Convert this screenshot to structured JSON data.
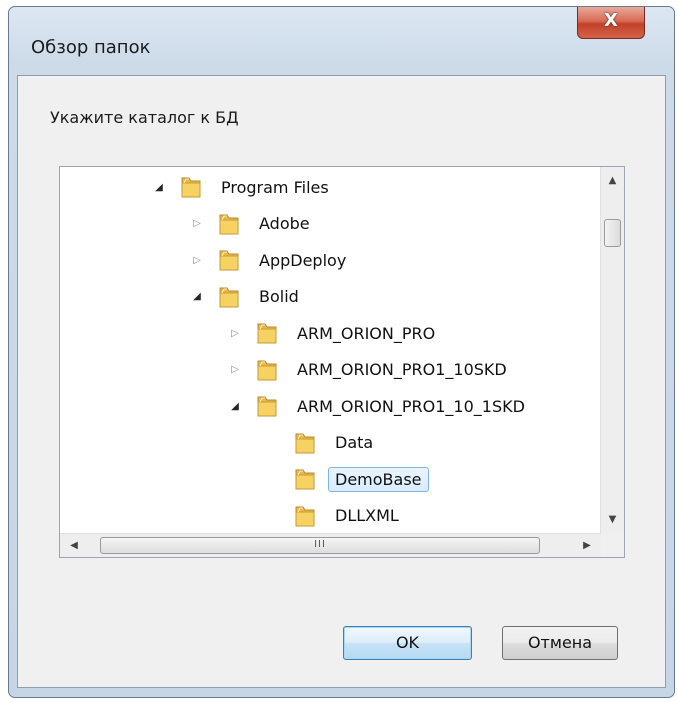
{
  "window": {
    "title": "Обзор папок",
    "close_glyph": "X"
  },
  "dialog": {
    "prompt": "Укажите каталог к БД"
  },
  "tree": {
    "nodes": [
      {
        "label": "Program Files",
        "depth": 0,
        "expander": "open"
      },
      {
        "label": "Adobe",
        "depth": 1,
        "expander": "closed"
      },
      {
        "label": "AppDeploy",
        "depth": 1,
        "expander": "closed"
      },
      {
        "label": "Bolid",
        "depth": 1,
        "expander": "open"
      },
      {
        "label": "ARM_ORION_PRO",
        "depth": 2,
        "expander": "closed"
      },
      {
        "label": "ARM_ORION_PRO1_10SKD",
        "depth": 2,
        "expander": "closed"
      },
      {
        "label": "ARM_ORION_PRO1_10_1SKD",
        "depth": 2,
        "expander": "open"
      },
      {
        "label": "Data",
        "depth": 3,
        "expander": "none"
      },
      {
        "label": "DemoBase",
        "depth": 3,
        "expander": "none",
        "selected": true
      },
      {
        "label": "DLLXML",
        "depth": 3,
        "expander": "none"
      }
    ],
    "hscroll_grip": "III"
  },
  "buttons": {
    "ok_label": "OK",
    "cancel_label": "Отмена"
  },
  "colors": {
    "selection_border": "#7fb4e6",
    "folder_yellow": "#f5d262",
    "close_red": "#c2412b"
  },
  "icons": {
    "folder": "folder-icon",
    "expand_open": "expanded-triangle-icon",
    "expand_closed": "collapsed-triangle-icon"
  }
}
